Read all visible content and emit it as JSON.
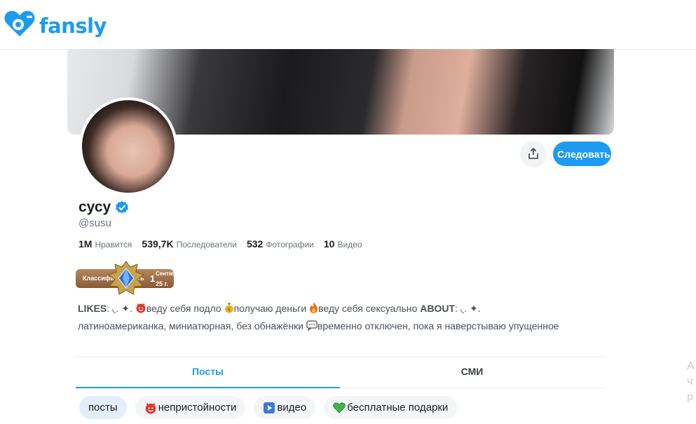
{
  "app": {
    "name": "fansly",
    "brand_color": "#1d9bf0"
  },
  "header": {
    "logo_text": "fansly"
  },
  "profile": {
    "display_name": "сусу",
    "handle": "@susu",
    "verified": true,
    "follow_label": "Следовать",
    "share_icon": "share-icon",
    "stats": [
      {
        "value": "1M",
        "label": "Нравится"
      },
      {
        "value": "539,7K",
        "label": "Последователи"
      },
      {
        "value": "532",
        "label": "Фотографии"
      },
      {
        "value": "10",
        "label": "Видео"
      }
    ],
    "rank_badge": {
      "label": "Классифицировать",
      "number": "1",
      "date_line1": "Сентябр...",
      "date_line2": "25 г."
    },
    "bio": {
      "likes_label": "LIKES",
      "likes_sep": ": ◟. ✦. ",
      "item1": "веду себя подло",
      "item2": "получаю деньги",
      "item3": "веду себя сексуально",
      "about_label": "ABOUT",
      "about_sep": ": ◟. ✦.",
      "about_text": "латиноамериканка, миниатюрная, без обнажёнки",
      "status_text": "временно отключен, пока я наверстываю упущенное"
    }
  },
  "tabs": [
    {
      "label": "Посты",
      "active": true
    },
    {
      "label": "СМИ",
      "active": false
    }
  ],
  "chips": [
    {
      "label": "посты",
      "active": true
    },
    {
      "label": "непристойности",
      "icon": "devil-icon"
    },
    {
      "label": "видео",
      "icon": "play-icon"
    },
    {
      "label": "бесплатные подарки",
      "icon": "green-heart-icon"
    }
  ],
  "side_clip": {
    "l1": "А",
    "l2": "ч",
    "l3": "р"
  }
}
